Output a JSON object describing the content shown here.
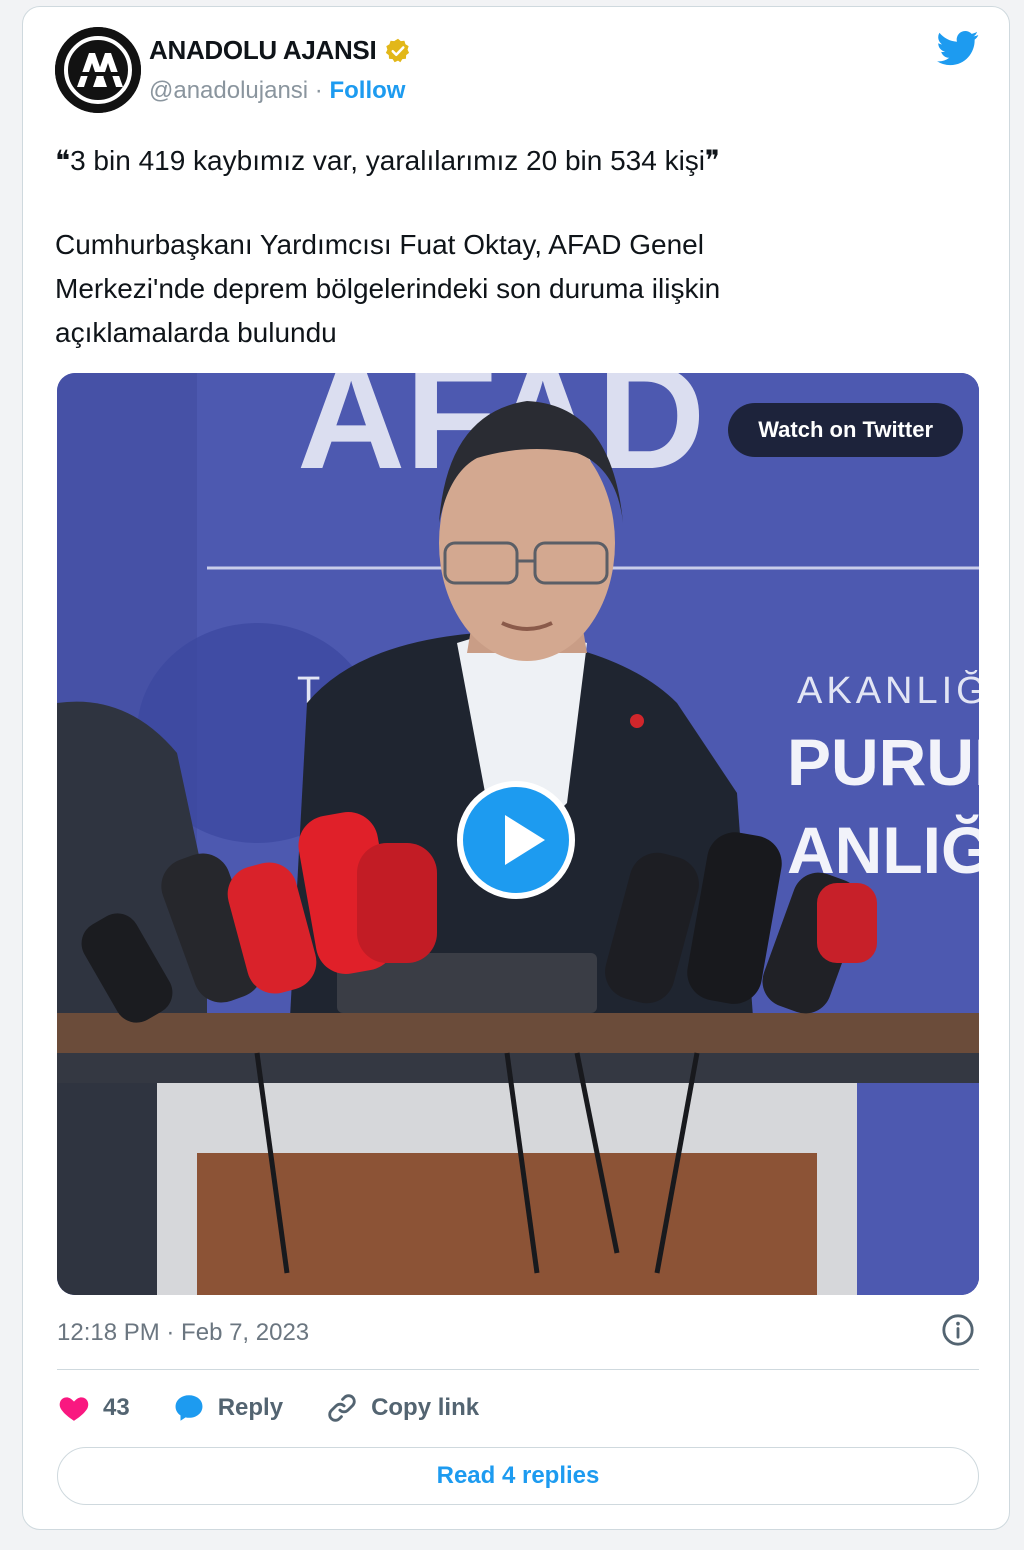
{
  "author": {
    "display_name": "ANADOLU AJANSI",
    "handle": "@anadolujansi",
    "separator": " · ",
    "follow_label": "Follow",
    "verified": true
  },
  "tweet": {
    "quote": "❝3 bin 419 kaybımız var, yaralılarımız 20 bin 534 kişi❞",
    "line1": "Cumhurbaşkanı Yardımcısı Fuat Oktay, AFAD Genel",
    "line2": "Merkezi'nde deprem bölgelerindeki son duruma ilişkin",
    "line3": "açıklamalarda bulundu"
  },
  "media": {
    "watch_label": "Watch on Twitter",
    "backdrop_text": {
      "top": "AFAD",
      "mid": "T",
      "mid2": "AKANLIĞ",
      "big1": "PURUM",
      "big2": "ANLIĞ"
    }
  },
  "meta": {
    "timestamp": "12:18 PM · Feb 7, 2023"
  },
  "actions": {
    "likes": "43",
    "reply_label": "Reply",
    "copy_label": "Copy link",
    "read_replies_label": "Read 4 replies"
  },
  "colors": {
    "accent": "#1d9bf0",
    "like": "#f91880",
    "verified_badge": "#e2b719",
    "backdrop": "#4b56ab"
  }
}
